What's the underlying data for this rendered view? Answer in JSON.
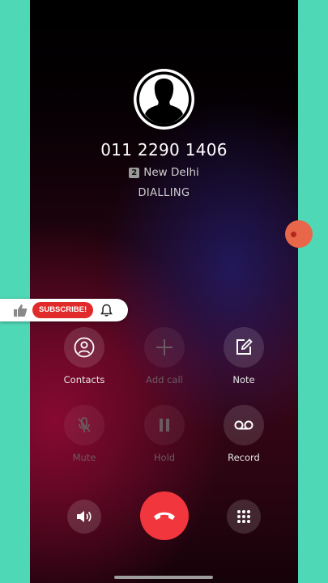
{
  "call": {
    "number": "011 2290 1406",
    "sim_slot": "2",
    "location": "New Delhi",
    "status": "DIALLING"
  },
  "controls": {
    "contacts": {
      "label": "Contacts",
      "icon": "person-circle-icon",
      "enabled": true
    },
    "add_call": {
      "label": "Add call",
      "icon": "plus-icon",
      "enabled": false
    },
    "note": {
      "label": "Note",
      "icon": "edit-note-icon",
      "enabled": true
    },
    "mute": {
      "label": "Mute",
      "icon": "microphone-muted-icon",
      "enabled": false
    },
    "hold": {
      "label": "Hold",
      "icon": "pause-icon",
      "enabled": false
    },
    "record": {
      "label": "Record",
      "icon": "voicemail-record-icon",
      "enabled": true
    }
  },
  "bottom": {
    "speaker_icon": "speaker-volume-icon",
    "end_call_icon": "phone-hangup-icon",
    "keypad_icon": "dialpad-icon"
  },
  "overlay": {
    "subscribe_label": "SUBSCRIBE!",
    "like_icon": "thumbs-up-icon",
    "bell_icon": "bell-icon"
  },
  "colors": {
    "background_side": "#4fd8b6",
    "end_call": "#f1363e",
    "subscribe": "#e12b2b"
  }
}
